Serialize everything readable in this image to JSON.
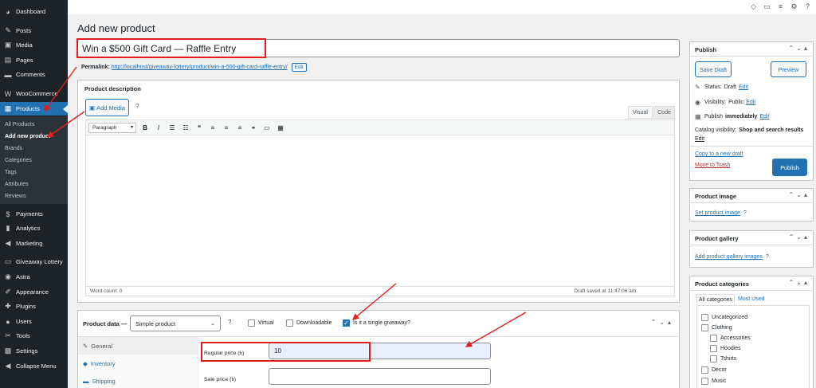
{
  "sidebar": {
    "items": [
      {
        "label": "Dashboard",
        "icon": "dashboard-icon",
        "glyph": "◕"
      },
      {
        "label": "Posts",
        "icon": "pin-icon",
        "glyph": "✎"
      },
      {
        "label": "Media",
        "icon": "media-icon",
        "glyph": "▣"
      },
      {
        "label": "Pages",
        "icon": "pages-icon",
        "glyph": "▤"
      },
      {
        "label": "Comments",
        "icon": "comment-icon",
        "glyph": "▬"
      },
      {
        "label": "WooCommerce",
        "icon": "woo-icon",
        "glyph": "W"
      },
      {
        "label": "Products",
        "icon": "archive-icon",
        "glyph": "▦"
      },
      {
        "label": "Payments",
        "icon": "dollar-icon",
        "glyph": "$"
      },
      {
        "label": "Analytics",
        "icon": "chart-icon",
        "glyph": "▮"
      },
      {
        "label": "Marketing",
        "icon": "megaphone-icon",
        "glyph": "◀"
      },
      {
        "label": "Giveaway Lottery",
        "icon": "ticket-icon",
        "glyph": "▭"
      },
      {
        "label": "Astra",
        "icon": "astra-icon",
        "glyph": "◉"
      },
      {
        "label": "Appearance",
        "icon": "brush-icon",
        "glyph": "✐"
      },
      {
        "label": "Plugins",
        "icon": "plug-icon",
        "glyph": "✚"
      },
      {
        "label": "Users",
        "icon": "user-icon",
        "glyph": "●"
      },
      {
        "label": "Tools",
        "icon": "wrench-icon",
        "glyph": "✂"
      },
      {
        "label": "Settings",
        "icon": "settings-icon",
        "glyph": "▩"
      },
      {
        "label": "Collapse Menu",
        "icon": "collapse-icon",
        "glyph": "◀"
      }
    ],
    "submenu": [
      "All Products",
      "Add new product",
      "Brands",
      "Categories",
      "Tags",
      "Attributes",
      "Reviews"
    ]
  },
  "topbar": {
    "icons": [
      "◇",
      "▭",
      "≡",
      "⚙",
      "?"
    ]
  },
  "page_title": "Add new product",
  "title_value": "Win a $500 Gift Card — Raffle Entry",
  "permalink": {
    "label": "Permalink:",
    "url": "http://localhost/giveaway-lottery/product/win-a-500-gift-card-raffle-entry/",
    "edit": "Edit"
  },
  "description": {
    "title": "Product description",
    "add_media": "Add Media",
    "help": "?",
    "tab_visual": "Visual",
    "tab_code": "Code",
    "format": "Paragraph",
    "tools": [
      "B",
      "I",
      "☰",
      "☷",
      "❝",
      "≡",
      "≡",
      "≡",
      "⚭",
      "▭",
      "▦"
    ],
    "word_count": "Word count: 0",
    "draft_saved": "Draft saved at 11:47:06 am."
  },
  "product_data": {
    "label": "Product data —",
    "type": "Simple product",
    "help": "?",
    "virtual": "Virtual",
    "downloadable": "Downloadable",
    "giveaway": "Is it a single giveaway?",
    "controls": "⌃⌄▴",
    "tabs": [
      {
        "label": "General",
        "glyph": "✎"
      },
      {
        "label": "Inventory",
        "glyph": "◆"
      },
      {
        "label": "Shipping",
        "glyph": "▬"
      }
    ],
    "regular_price_label": "Regular price (৳)",
    "regular_price_value": "10",
    "sale_price_label": "Sale price (৳)",
    "sale_price_value": ""
  },
  "publish": {
    "title": "Publish",
    "controls": "⌃⌄▴",
    "save_draft": "Save Draft",
    "preview": "Preview",
    "status_label": "Status:",
    "status_value": "Draft",
    "visibility_label": "Visibility:",
    "visibility_value": "Public",
    "publish_label": "Publish",
    "publish_value": "immediately",
    "catalog_label": "Catalog visibility:",
    "catalog_value": "Shop and search results",
    "edit": "Edit",
    "copy": "Copy to a new draft",
    "trash": "Move to Trash",
    "publish_btn": "Publish"
  },
  "image_box": {
    "title": "Product image",
    "controls": "⌃⌄▴",
    "link": "Set product image",
    "help": "?"
  },
  "gallery_box": {
    "title": "Product gallery",
    "controls": "⌃⌄▴",
    "link": "Add product gallery images",
    "help": "?"
  },
  "categories_box": {
    "title": "Product categories",
    "controls": "⌃⌄▴",
    "tab_all": "All categories",
    "tab_used": "Most Used",
    "items": [
      "Uncategorized",
      "Clothing",
      "Accessories",
      "Hoodies",
      "Tshirts",
      "Decor",
      "Music"
    ]
  },
  "colors": {
    "accent": "#2271b1",
    "sidebar": "#1d2327",
    "annotation": "#e01e1e"
  }
}
